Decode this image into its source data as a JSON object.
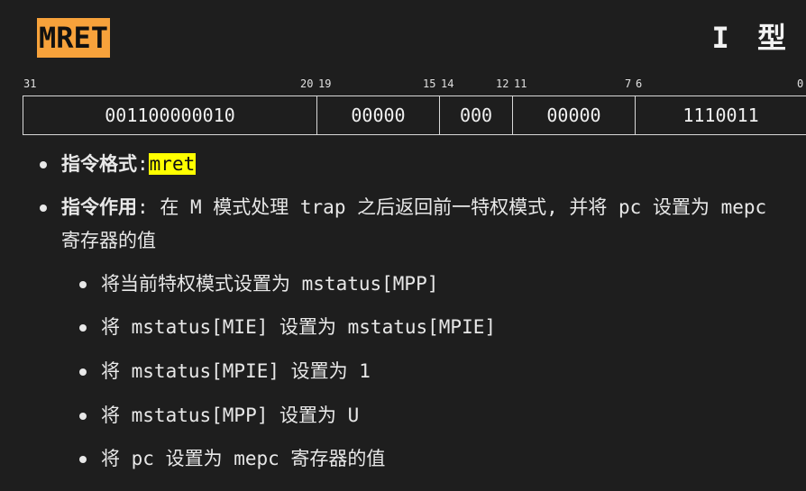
{
  "header": {
    "title": "MRET",
    "type_label": "I 型"
  },
  "bit_labels": [
    "31",
    "20",
    "19",
    "15",
    "14",
    "12",
    "11",
    "7",
    "6",
    "0"
  ],
  "fields": [
    "001100000010",
    "00000",
    "000",
    "00000",
    "1110011"
  ],
  "format": {
    "label": "指令格式",
    "sep": ":",
    "code": "mret"
  },
  "effect": {
    "label": "指令作用",
    "sep": ":",
    "text_line1": "在 M 模式处理 trap 之后返回前一特权模式, 并将 pc 设置为 mepc",
    "text_line2": "寄存器的值"
  },
  "steps": [
    "将当前特权模式设置为 mstatus[MPP]",
    "将 mstatus[MIE] 设置为 mstatus[MPIE]",
    "将 mstatus[MPIE] 设置为 1",
    "将 mstatus[MPP] 设置为 U",
    "将 pc 设置为 mepc 寄存器的值"
  ],
  "colors": {
    "background": "#1e1e1e",
    "title_bg": "#f7a23b",
    "highlight": "#ffff00"
  }
}
